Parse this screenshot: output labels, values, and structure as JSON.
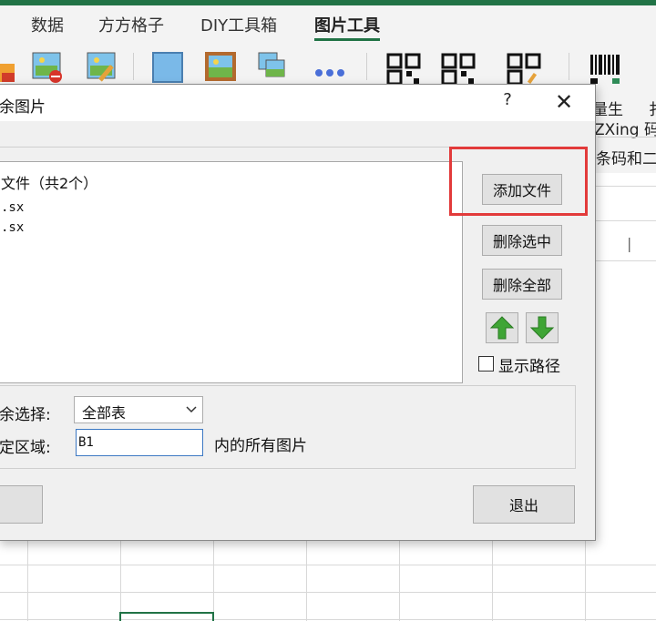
{
  "ribbon": {
    "tabs": [
      "数据",
      "方方格子",
      "DIY工具箱",
      "图片工具"
    ],
    "active_tab": "图片工具",
    "accent_color": "#217346",
    "right_texts": {
      "line1": "量生",
      "line1b": "扌",
      "line2": "ZXing 码",
      "line3": "条码和二"
    }
  },
  "dialog": {
    "title": "余图片",
    "help_label": "?",
    "close_label": "✕",
    "file_list": {
      "header": "文件（共2个）",
      "items": [
        ".sx",
        ".sx"
      ]
    },
    "buttons": {
      "add_file": "添加文件",
      "delete_selected": "删除选中",
      "delete_all": "删除全部",
      "exit": "退出"
    },
    "show_path_label": "显示路径",
    "form": {
      "select_label": "余选择:",
      "select_value": "全部表",
      "range_label": "定区域:",
      "range_value": "B1",
      "range_suffix": "内的所有图片"
    },
    "highlight_color": "#e23a3a"
  },
  "sheet": {
    "selected_cell_color": "#217346",
    "cursor_mark": "|"
  }
}
